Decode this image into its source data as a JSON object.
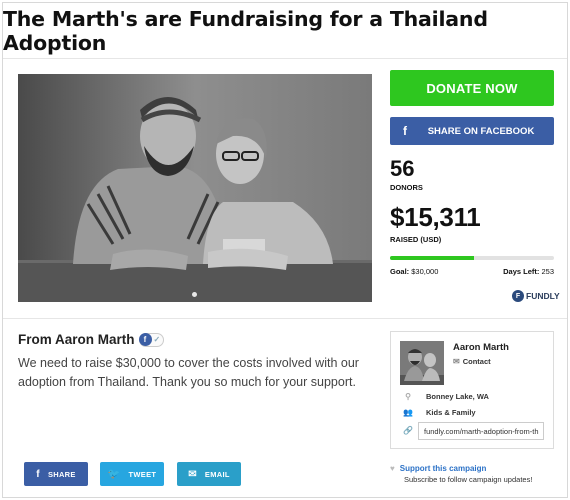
{
  "page": {
    "title": "The Marth's are Fundraising for a Thailand Adoption"
  },
  "campaign": {
    "donate_label": "DONATE NOW",
    "facebook_share_label": "SHARE ON FACEBOOK",
    "donors_count": "56",
    "donors_label": "DONORS",
    "raised_amount": "$15,311",
    "raised_label": "RAISED (USD)",
    "progress_fraction": 0.51,
    "goal_label": "Goal:",
    "goal_value": "$30,000",
    "days_left_label": "Days Left:",
    "days_left_value": "253",
    "brand": "FUNDLY",
    "brand_color": "#2b4a7c",
    "donate_color": "#2ec71f"
  },
  "story": {
    "from_label": "From Aaron Marth",
    "text": "We need to raise $30,000 to cover the costs involved with our adoption from Thailand. Thank you so much for your support."
  },
  "organizer": {
    "name": "Aaron Marth",
    "contact_label": "Contact",
    "location": "Bonney Lake, WA",
    "category": "Kids & Family",
    "url": "fundly.com/marth-adoption-from-th"
  },
  "share": {
    "facebook": "SHARE",
    "twitter": "TWEET",
    "email": "EMAIL"
  },
  "support": {
    "link": "Support this campaign",
    "subtext": "Subscribe to follow campaign updates!"
  },
  "icons": {
    "facebook": "facebook-icon",
    "twitter": "twitter-icon",
    "email": "email-icon",
    "envelope": "envelope-icon",
    "location": "location-pin-icon",
    "category": "people-icon",
    "link": "link-icon",
    "heart": "heart-icon",
    "verified": "checkmark-icon"
  }
}
